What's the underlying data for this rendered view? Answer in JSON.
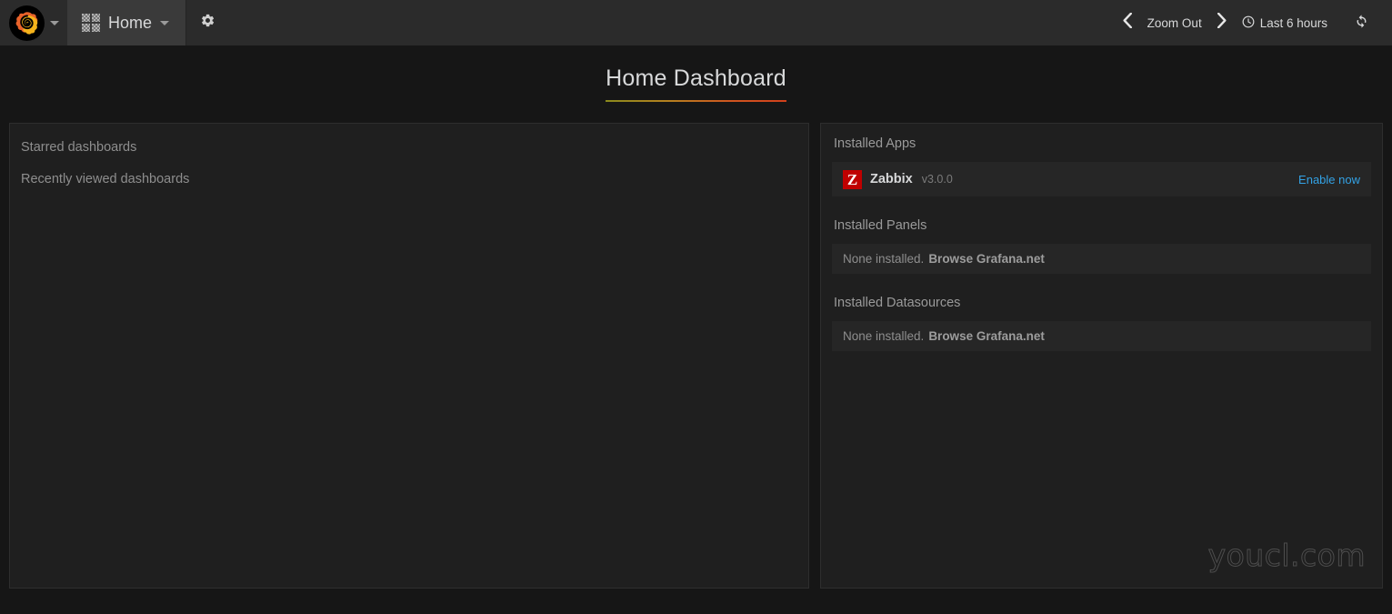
{
  "navbar": {
    "logo_icon": "grafana-logo-icon",
    "logo_caret_icon": "chevron-down-icon",
    "home": {
      "icon": "grid-squares-icon",
      "label": "Home",
      "caret_icon": "chevron-down-icon"
    },
    "settings_icon": "gear-icon",
    "prev_icon": "chevron-left-icon",
    "zoom_out_label": "Zoom Out",
    "next_icon": "chevron-right-icon",
    "time_range": {
      "icon": "clock-icon",
      "label": "Last 6 hours"
    },
    "refresh_icon": "refresh-icon"
  },
  "dashboard": {
    "title": "Home Dashboard"
  },
  "left_panel": {
    "starred_label": "Starred dashboards",
    "recent_label": "Recently viewed dashboards"
  },
  "right_panel": {
    "apps": {
      "heading": "Installed Apps",
      "items": [
        {
          "logo_letter": "Z",
          "name": "Zabbix",
          "version": "v3.0.0",
          "action": "Enable now"
        }
      ]
    },
    "panels": {
      "heading": "Installed Panels",
      "empty_text": "None installed.",
      "empty_link": "Browse Grafana.net"
    },
    "datasources": {
      "heading": "Installed Datasources",
      "empty_text": "None installed.",
      "empty_link": "Browse Grafana.net"
    },
    "watermark": "youcl.com"
  },
  "colors": {
    "navbar_bg": "#2b2b2b",
    "page_bg": "#161616",
    "panel_bg": "#1f1f1f",
    "row_bg": "#262626",
    "link_blue": "#33a2e5",
    "zabbix_red": "#c00000",
    "text_primary": "#d8d9da",
    "text_muted": "#8e8e8e"
  }
}
